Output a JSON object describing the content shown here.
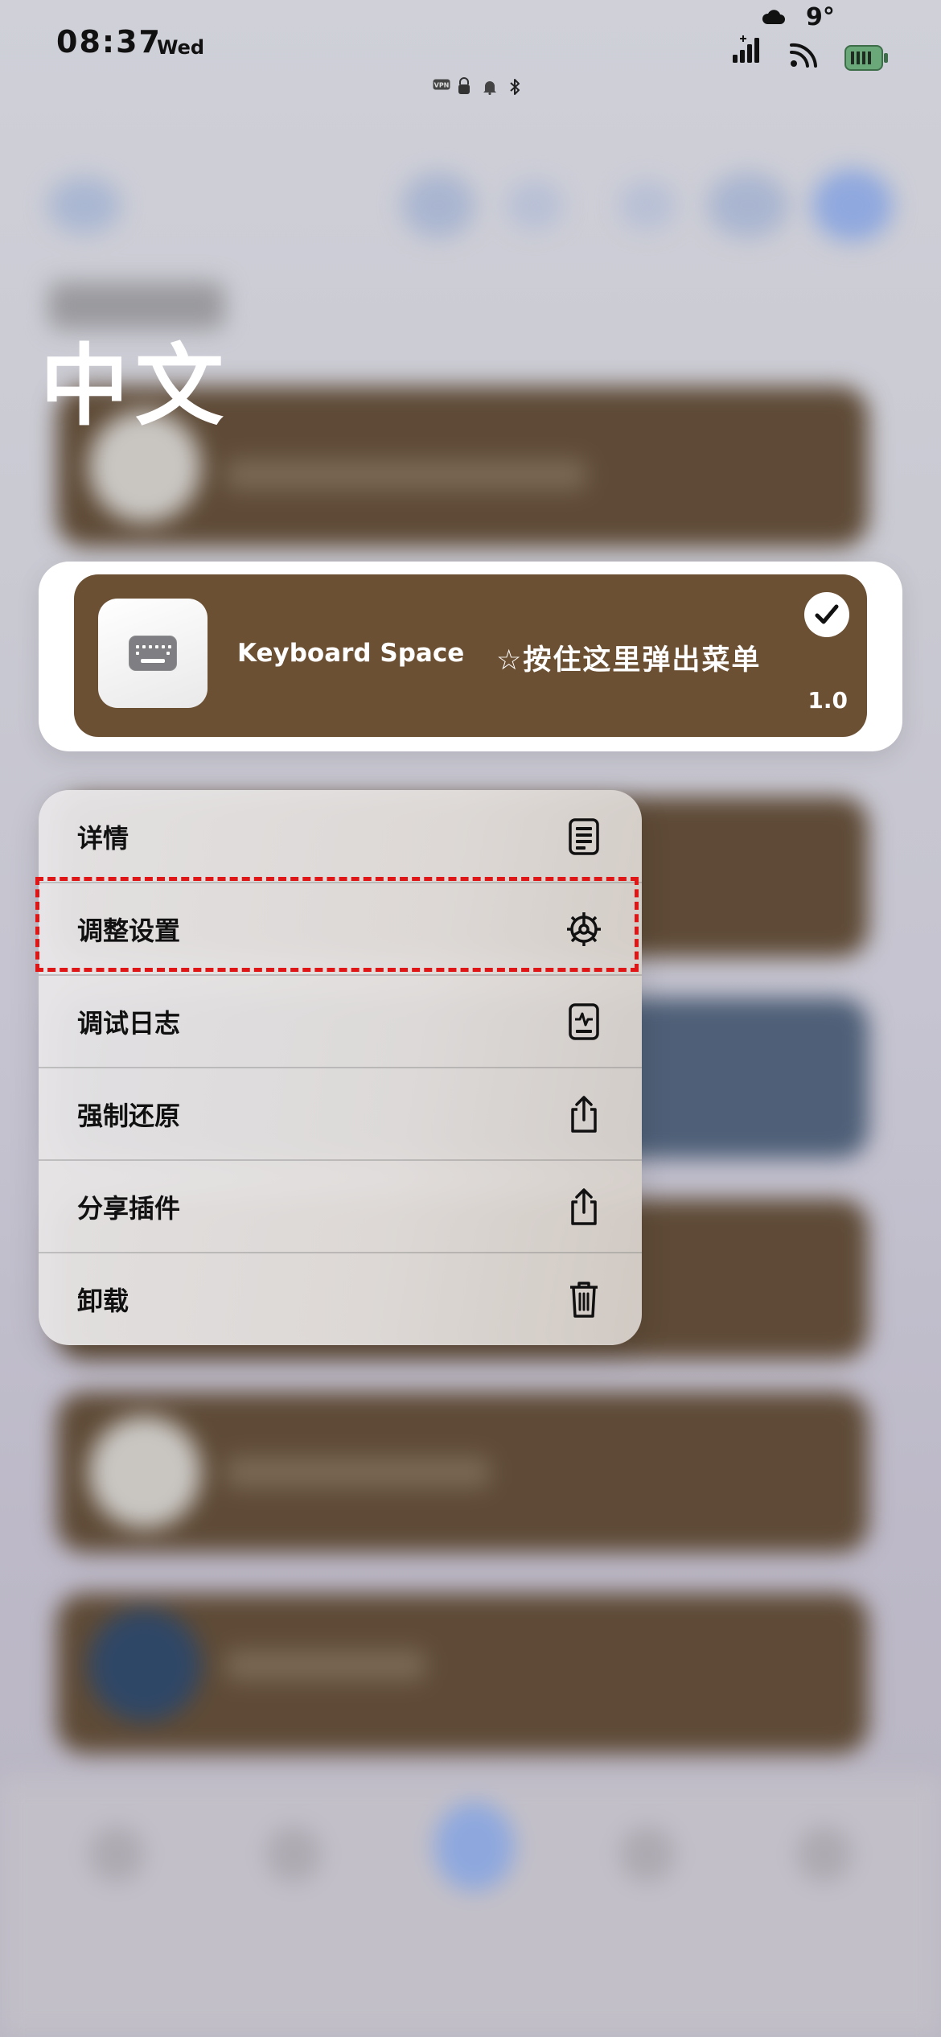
{
  "status_bar": {
    "time": "08:37",
    "day": "Wed",
    "temperature": "9°",
    "mini_icons": [
      "vpn-icon",
      "lock-icon",
      "bell-icon",
      "bluetooth-icon"
    ],
    "mini_vpn": "VPN"
  },
  "page": {
    "heading": "中文"
  },
  "plugin_card": {
    "icon": "keyboard-icon",
    "name": "Keyboard Space",
    "hint": "☆按住这里弹出菜单",
    "version": "1.0",
    "enabled": true,
    "colors": {
      "card": "#6c5033",
      "frame": "#ffffff"
    }
  },
  "menu": {
    "items": [
      {
        "label": "详情",
        "icon": "document-icon"
      },
      {
        "label": "调整设置",
        "icon": "gear-icon",
        "highlighted": true
      },
      {
        "label": "调试日志",
        "icon": "log-icon"
      },
      {
        "label": "强制还原",
        "icon": "share-icon"
      },
      {
        "label": "分享插件",
        "icon": "share-icon"
      },
      {
        "label": "卸载",
        "icon": "trash-icon"
      }
    ],
    "highlight_color": "#e01515"
  }
}
